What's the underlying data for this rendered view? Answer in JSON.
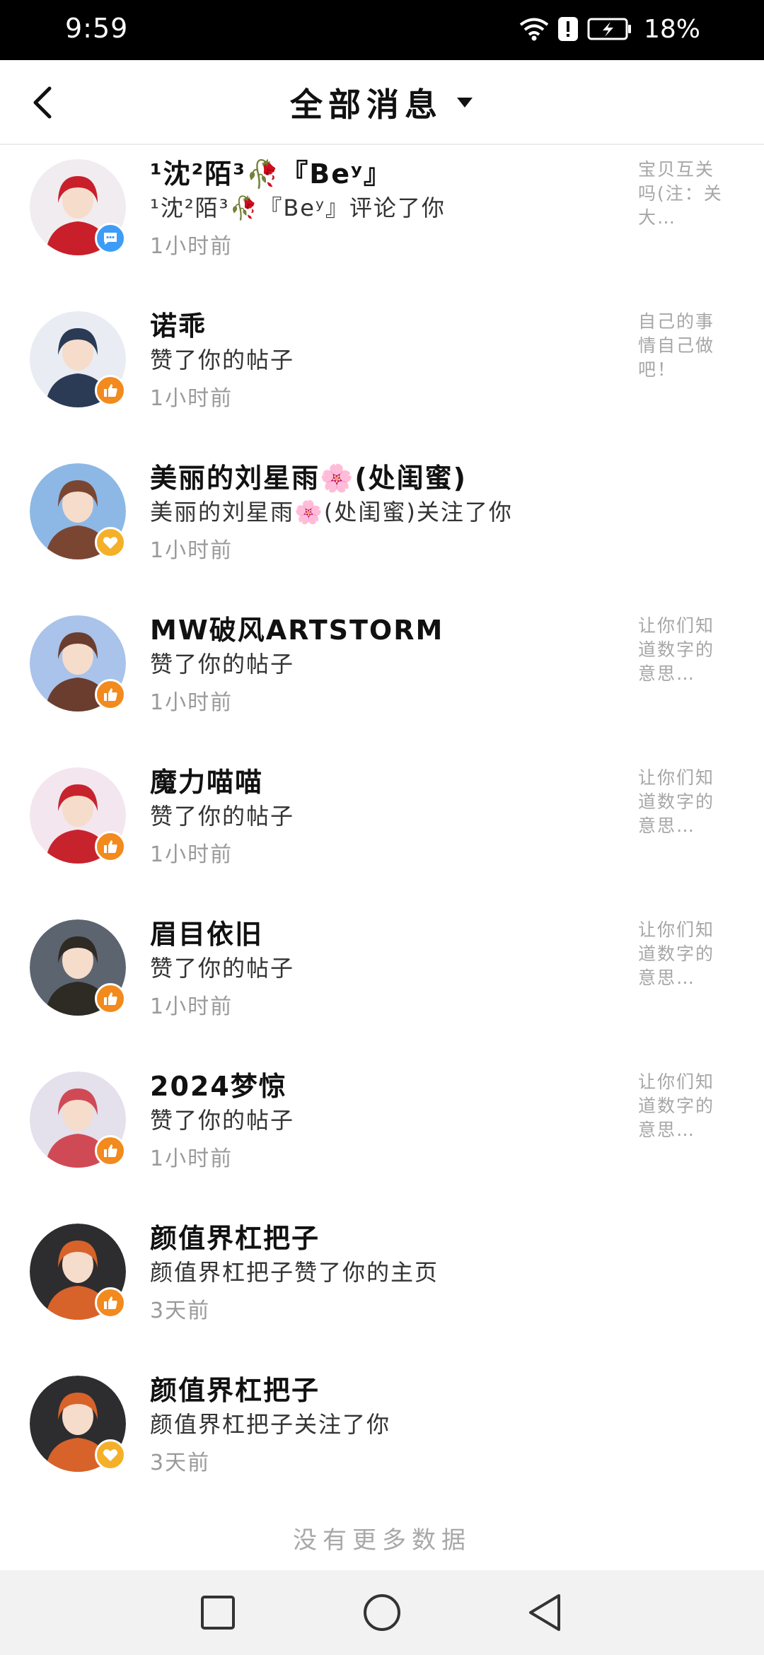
{
  "status_bar": {
    "time": "9:59",
    "battery": "18%"
  },
  "header": {
    "title": "全部消息"
  },
  "colors": {
    "like_badge": "#f28a1e",
    "follow_badge": "#f5b02a",
    "comment_badge": "#3d9cf5"
  },
  "messages": [
    {
      "name": "¹沈²陌³🥀『Beʸ』",
      "action": "¹沈²陌³🥀『Beʸ』评论了你",
      "time": "1小时前",
      "preview": "宝贝互关吗(注：关大…",
      "badge_icon": "comment-icon",
      "avatar_colors": [
        "#f1ecef",
        "#c81f2b"
      ]
    },
    {
      "name": "诺乖",
      "action": "赞了你的帖子",
      "time": "1小时前",
      "preview": "自己的事情自己做吧！",
      "badge_icon": "thumbs-up-icon",
      "avatar_colors": [
        "#e9ecf3",
        "#2b3a55"
      ]
    },
    {
      "name": "美丽的刘星雨🌸(处闺蜜)",
      "action": "美丽的刘星雨🌸(处闺蜜)关注了你",
      "time": "1小时前",
      "preview": "",
      "badge_icon": "heart-icon",
      "avatar_colors": [
        "#8db8e6",
        "#7a4632"
      ]
    },
    {
      "name": "MW破风ARTSTORM",
      "action": "赞了你的帖子",
      "time": "1小时前",
      "preview": "让你们知道数字的意思…",
      "badge_icon": "thumbs-up-icon",
      "avatar_colors": [
        "#a9c3ea",
        "#6b3d2e"
      ]
    },
    {
      "name": "魔力喵喵",
      "action": "赞了你的帖子",
      "time": "1小时前",
      "preview": "让你们知道数字的意思…",
      "badge_icon": "thumbs-up-icon",
      "avatar_colors": [
        "#f3e6ef",
        "#c7232d"
      ]
    },
    {
      "name": "眉目依旧",
      "action": "赞了你的帖子",
      "time": "1小时前",
      "preview": "让你们知道数字的意思…",
      "badge_icon": "thumbs-up-icon",
      "avatar_colors": [
        "#5c6470",
        "#2e2a24"
      ]
    },
    {
      "name": "2024梦惊",
      "action": "赞了你的帖子",
      "time": "1小时前",
      "preview": "让你们知道数字的意思…",
      "badge_icon": "thumbs-up-icon",
      "avatar_colors": [
        "#e4e0ec",
        "#d04a55"
      ]
    },
    {
      "name": "颜值界杠把子",
      "action": "颜值界杠把子赞了你的主页",
      "time": "3天前",
      "preview": "",
      "badge_icon": "thumbs-up-icon",
      "avatar_colors": [
        "#2d2d2f",
        "#d8632a"
      ]
    },
    {
      "name": "颜值界杠把子",
      "action": "颜值界杠把子关注了你",
      "time": "3天前",
      "preview": "",
      "badge_icon": "heart-icon",
      "avatar_colors": [
        "#2d2d2f",
        "#d8632a"
      ]
    }
  ],
  "list_end_text": "没有更多数据"
}
